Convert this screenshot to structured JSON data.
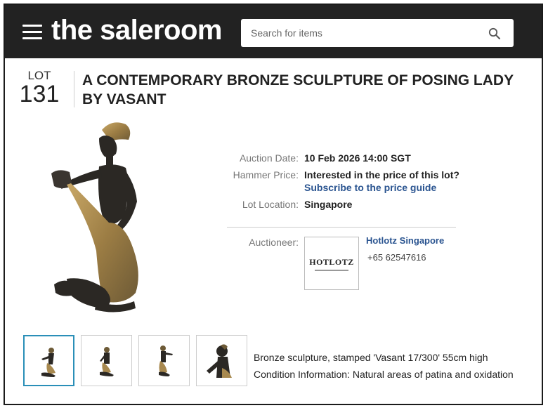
{
  "header": {
    "logo_text": "the saleroom",
    "search_placeholder": "Search for items",
    "icons": [
      "menu-icon",
      "search-icon"
    ]
  },
  "lot": {
    "label": "LOT",
    "number": "131",
    "title": "A CONTEMPORARY BRONZE SCULPTURE OF POSING LADY BY VASANT"
  },
  "details": {
    "auction_date_label": "Auction Date:",
    "auction_date_value": "10 Feb 2026 14:00 SGT",
    "hammer_price_label": "Hammer Price:",
    "hammer_price_value": "Interested in the price of this lot?",
    "hammer_price_link": "Subscribe to the price guide",
    "lot_location_label": "Lot Location:",
    "lot_location_value": "Singapore"
  },
  "auctioneer": {
    "label": "Auctioneer:",
    "logo_text": "HOTLOTZ",
    "name": "Hotlotz Singapore",
    "phone": "+65 62547616"
  },
  "description": {
    "line1": "Bronze sculpture, stamped 'Vasant 17/300'   55cm high",
    "line2": "Condition Information: Natural areas of patina and oxidation"
  },
  "colors": {
    "header_bg": "#222222",
    "link": "#2a5490",
    "thumb_active_border": "#2a8fb8",
    "bronze_dark": "#2b2824",
    "bronze_gold": "#a8894f"
  }
}
